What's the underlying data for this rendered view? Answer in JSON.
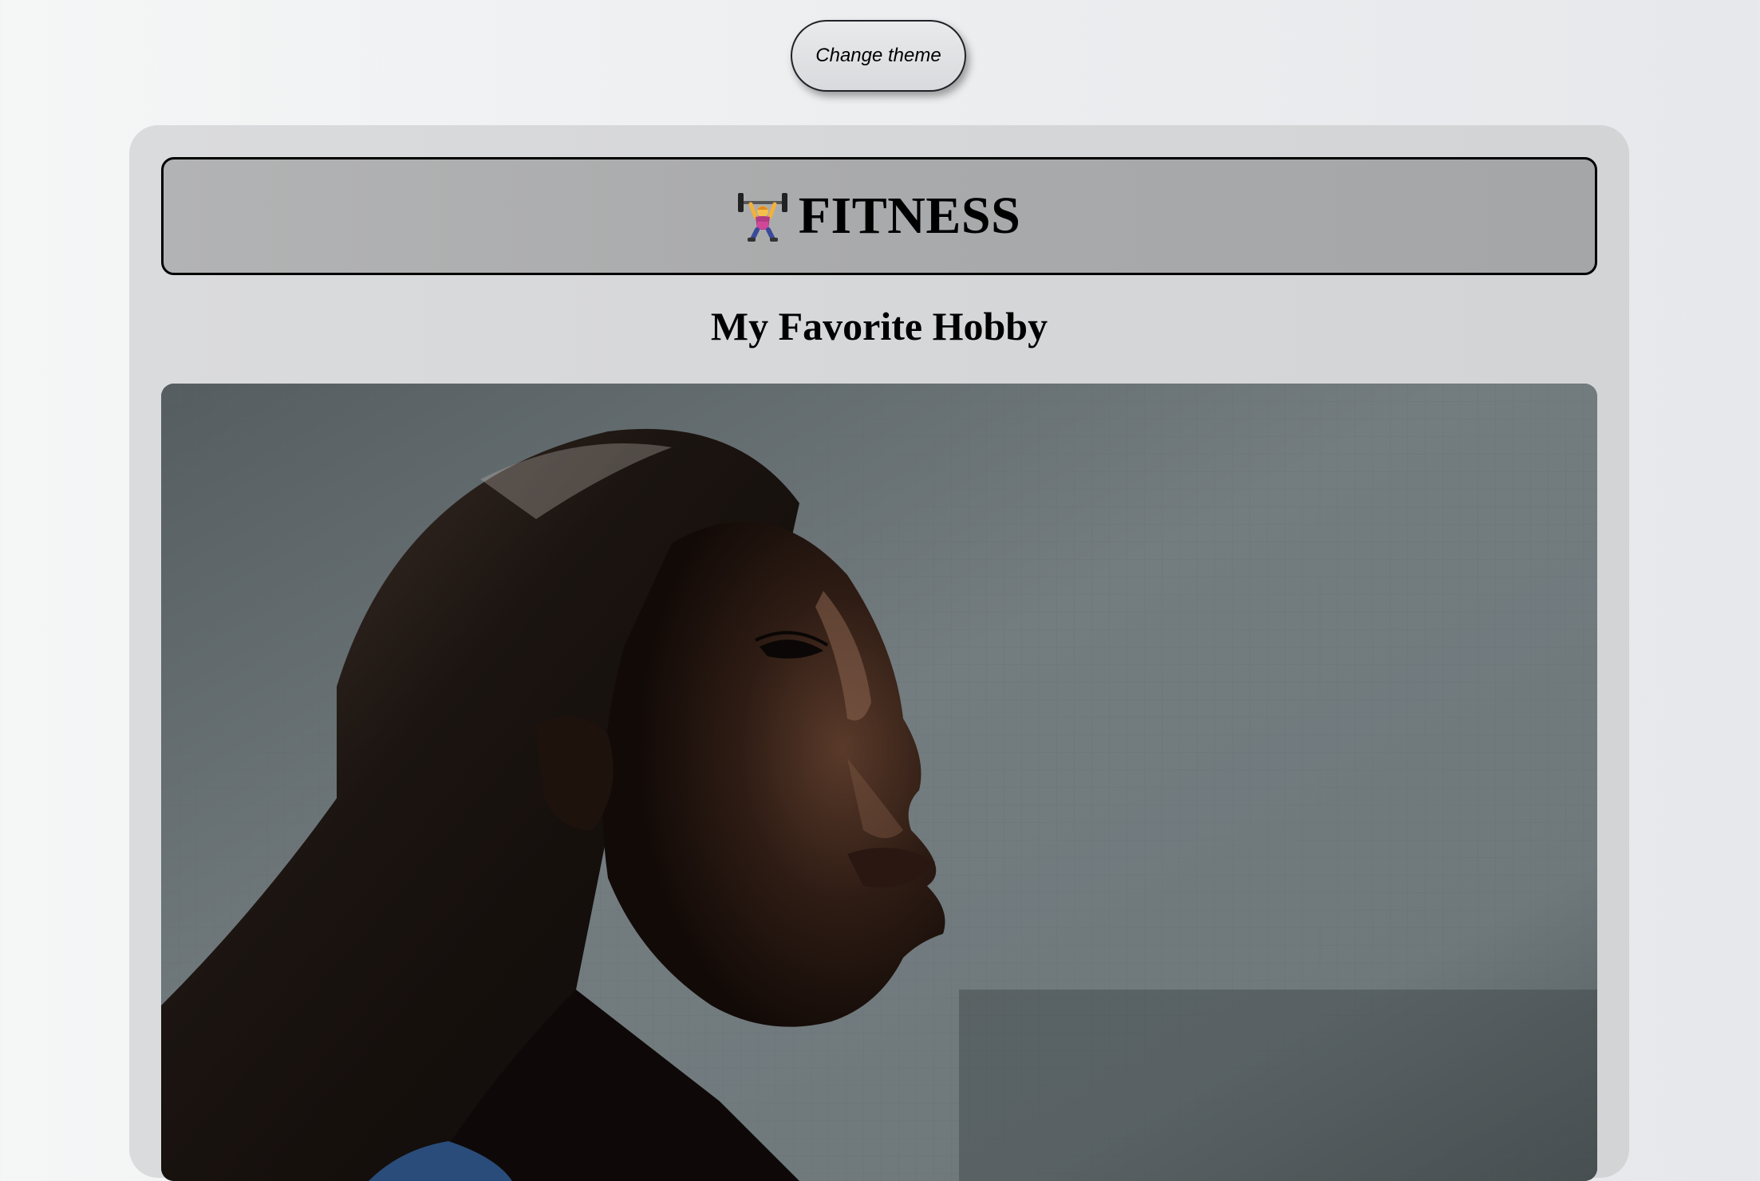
{
  "toolbar": {
    "change_theme_label": "Change theme"
  },
  "header": {
    "icon": "weightlifter-icon",
    "title": "FITNESS"
  },
  "main": {
    "subtitle": "My Favorite Hobby"
  },
  "colors": {
    "page_background": "#eceef0",
    "card_background": "#d6d7d9",
    "header_background": "#a9aaab",
    "button_background": "#e0e1e3"
  }
}
